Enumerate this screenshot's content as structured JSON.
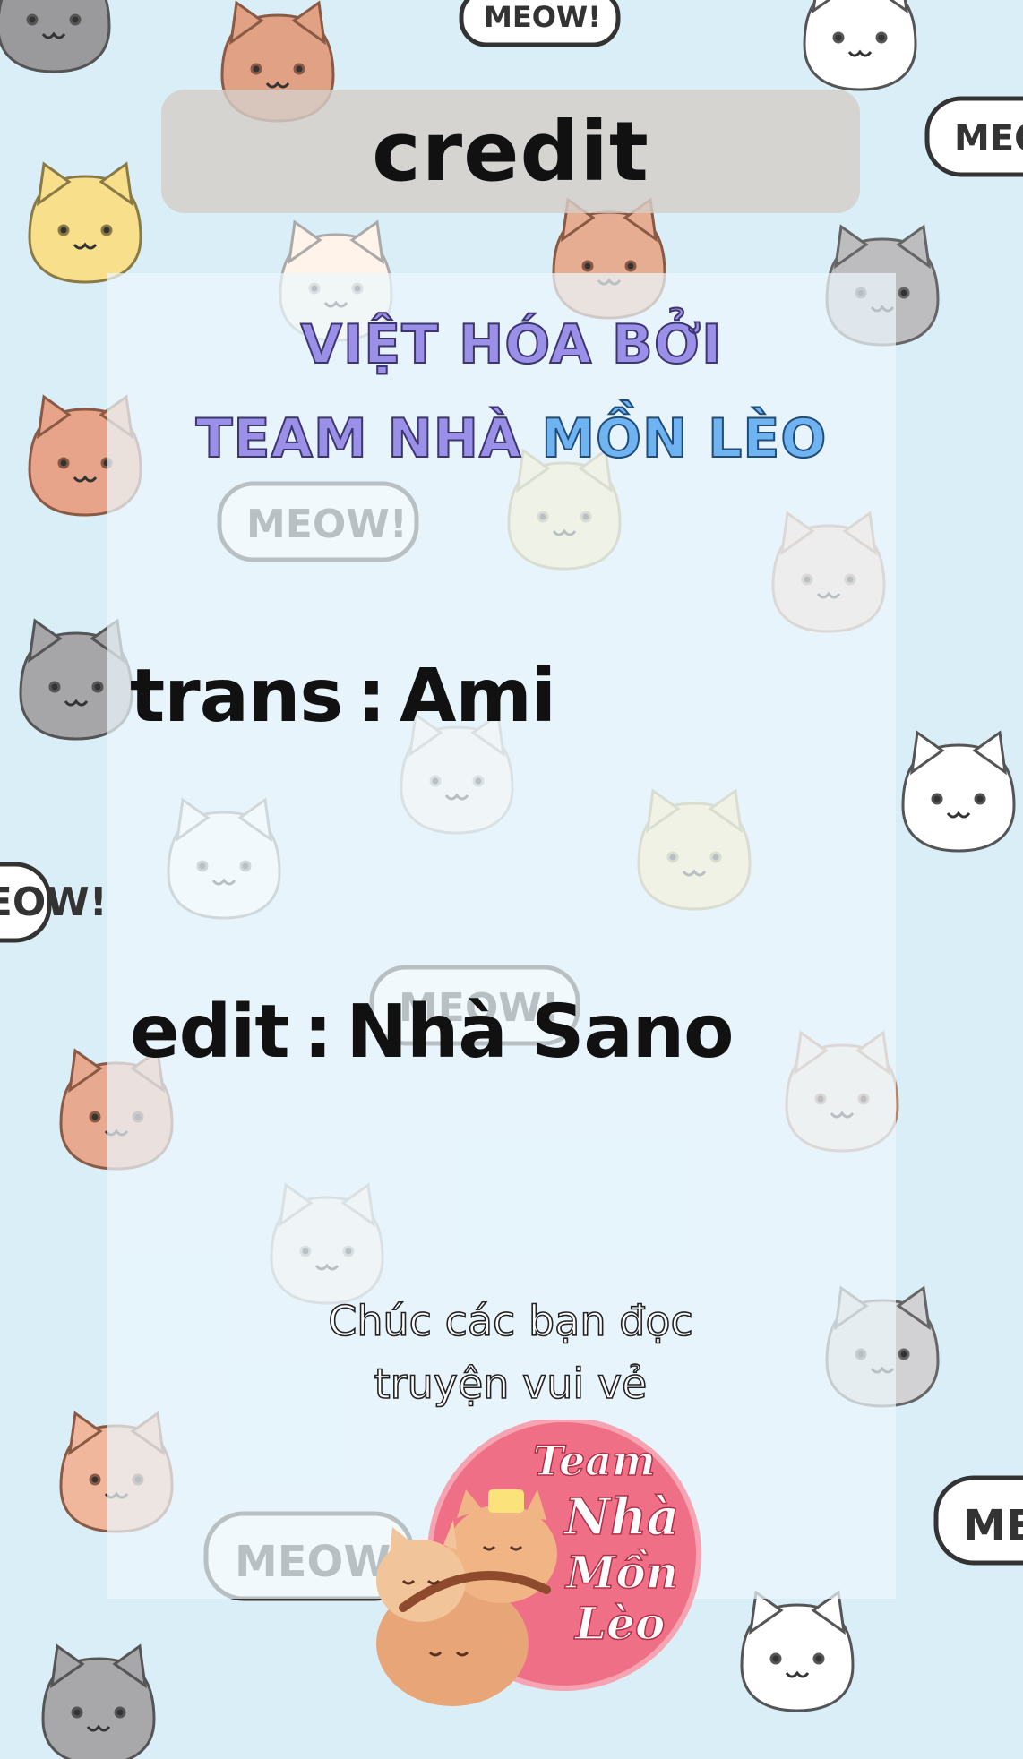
{
  "header": {
    "title": "credit"
  },
  "credits": {
    "line1": "VIỆT HÓA BỞI",
    "line2_prefix": "TEAM NHÀ ",
    "line2_highlight": "MỒN LÈO",
    "trans_label": "trans",
    "trans_name": "Ami",
    "edit_label": "edit",
    "edit_name": "Nhà Sano",
    "separator": ":"
  },
  "message": {
    "line1": "Chúc các bạn đọc",
    "line2": "truyện vui vẻ"
  },
  "logo": {
    "line1": "Team",
    "line2": "Nhà",
    "line3": "Mồn",
    "line4": "Lèo"
  },
  "bubble_text": "MEOW!",
  "colors": {
    "background": "#d9eef7",
    "heading_purple": "#9a90e8",
    "heading_blue": "#6fb3f0",
    "logo_pink": "#ef6f86"
  }
}
